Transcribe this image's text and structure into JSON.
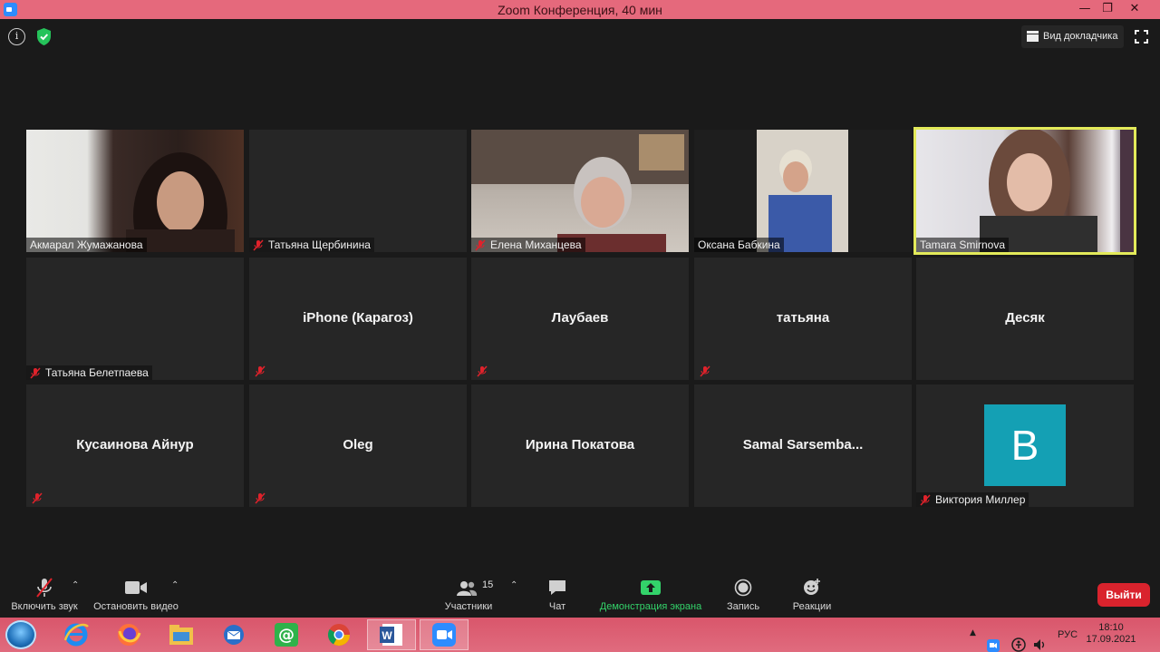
{
  "window": {
    "title": "Zoom Конференция, 40 мин",
    "controls": [
      "—",
      "❐",
      "✕"
    ]
  },
  "top_bar": {
    "speaker_view_label": "Вид докладчика",
    "info_glyph": "i"
  },
  "colors": {
    "titlebar": "#e5697c",
    "active_speaker_border": "#e3ea5a",
    "leave_button": "#d9232d",
    "share_green": "#33d36a",
    "avatar_teal": "#14a0b4"
  },
  "participants": [
    {
      "name": "Акмарал Жумажанова",
      "video": true,
      "muted": false
    },
    {
      "name": "Татьяна Щербинина",
      "video": false,
      "muted": true
    },
    {
      "name": "Елена Миханцева",
      "video": true,
      "muted": true
    },
    {
      "name": "Оксана Бабкина",
      "video": true,
      "muted": false
    },
    {
      "name": "Tamara Smirnova",
      "video": true,
      "muted": false,
      "active_speaker": true
    },
    {
      "name": "Татьяна Белетпаева",
      "video": false,
      "muted": true
    },
    {
      "name": "iPhone (Карагоз)",
      "video": false,
      "muted": true
    },
    {
      "name": "Лаубаев",
      "video": false,
      "muted": true
    },
    {
      "name": "татьяна",
      "video": false,
      "muted": true
    },
    {
      "name": "Десяк",
      "video": false,
      "muted": false
    },
    {
      "name": "Кусаинова Айнур",
      "video": false,
      "muted": true
    },
    {
      "name": "Oleg",
      "video": false,
      "muted": true
    },
    {
      "name": "Ирина Покатова",
      "video": false,
      "muted": false
    },
    {
      "name": "Samal  Sarsemba...",
      "video": false,
      "muted": false
    },
    {
      "name": "Виктория Миллер",
      "video": false,
      "muted": true,
      "avatar_letter": "B"
    }
  ],
  "toolbar": {
    "unmute_label": "Включить звук",
    "stop_video_label": "Остановить видео",
    "participants_label": "Участники",
    "participants_count": "15",
    "chat_label": "Чат",
    "share_label": "Демонстрация экрана",
    "record_label": "Запись",
    "reactions_label": "Реакции",
    "leave_label": "Выйти"
  },
  "taskbar": {
    "apps": [
      "ie-icon",
      "firefox-icon",
      "explorer-icon",
      "mail-icon",
      "mail-ru-agent-icon",
      "chrome-icon",
      "word-icon",
      "zoom-icon"
    ],
    "language": "РУС",
    "time": "18:10",
    "date": "17.09.2021"
  }
}
